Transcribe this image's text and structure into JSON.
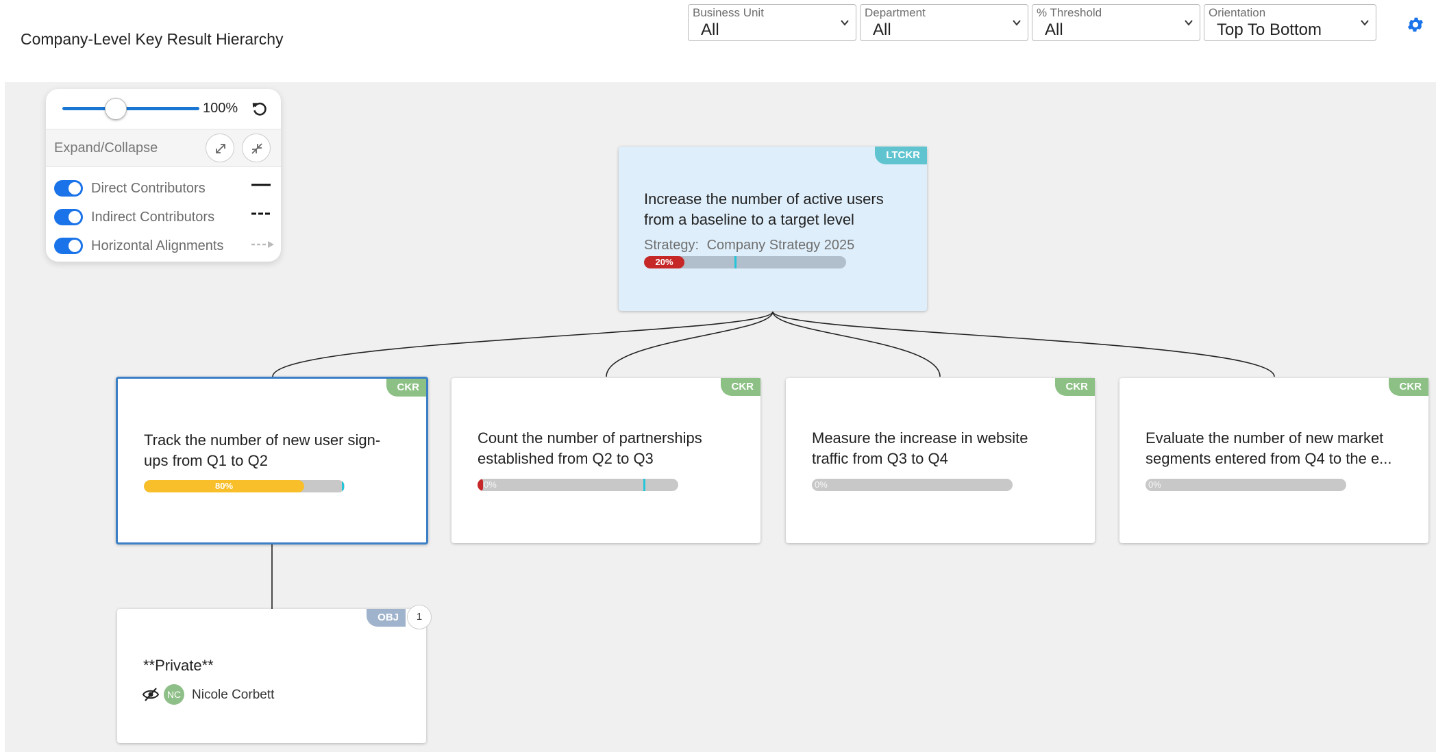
{
  "header": {
    "title": "Company-Level Key Result Hierarchy",
    "filters": [
      {
        "label": "Business Unit",
        "value": "All"
      },
      {
        "label": "Department",
        "value": "All"
      },
      {
        "label": "% Threshold",
        "value": "All"
      },
      {
        "label": "Orientation",
        "value": "Top To Bottom"
      }
    ],
    "settings_icon": "gear-icon"
  },
  "controls": {
    "zoom": "100%",
    "zoom_slider_fraction": 0.4,
    "expand_collapse_label": "Expand/Collapse",
    "toggles": [
      {
        "label": "Direct Contributors",
        "on": true,
        "legend": "solid-line"
      },
      {
        "label": "Indirect Contributors",
        "on": true,
        "legend": "dashed-line"
      },
      {
        "label": "Horizontal Alignments",
        "on": true,
        "legend": "dashed-arrow"
      }
    ]
  },
  "colors": {
    "accent": "#1a73e8",
    "selected_border": "#3b80c7",
    "ltckr_tag": "#5fc4cf",
    "ckr_tag": "#8cc084",
    "obj_tag": "#9fb3cc",
    "progress_red": "#c62828",
    "progress_yellow": "#f9bf2a",
    "target_marker": "#26c6da"
  },
  "root": {
    "tag": "LTCKR",
    "title_line1": "Increase the number of active users",
    "title_line2": "from a baseline to a target level",
    "strategy_label": "Strategy:",
    "strategy_value": "Company Strategy 2025",
    "progress": 20,
    "progress_text": "20%",
    "target": 45
  },
  "children": [
    {
      "tag": "CKR",
      "title_line1": "Track the number of new user sign-",
      "title_line2": "ups from Q1 to Q2",
      "progress": 80,
      "progress_text": "80%",
      "target": 99,
      "selected": true
    },
    {
      "tag": "CKR",
      "title_line1": "Count the number of partnerships",
      "title_line2": "established from Q2 to Q3",
      "progress": 0,
      "progress_text": "0%",
      "target": 83,
      "selected": false
    },
    {
      "tag": "CKR",
      "title_line1": "Measure the increase in website",
      "title_line2": "traffic from Q3 to Q4",
      "progress": 0,
      "progress_text": "0%",
      "selected": false
    },
    {
      "tag": "CKR",
      "title_line1": "Evaluate the number of new market",
      "title_line2": "segments entered from Q4 to the e...",
      "progress": 0,
      "progress_text": "0%",
      "selected": false
    }
  ],
  "objective": {
    "tag": "OBJ",
    "count": "1",
    "title": "**Private**",
    "owner_initials": "NC",
    "owner_name": "Nicole Corbett"
  }
}
